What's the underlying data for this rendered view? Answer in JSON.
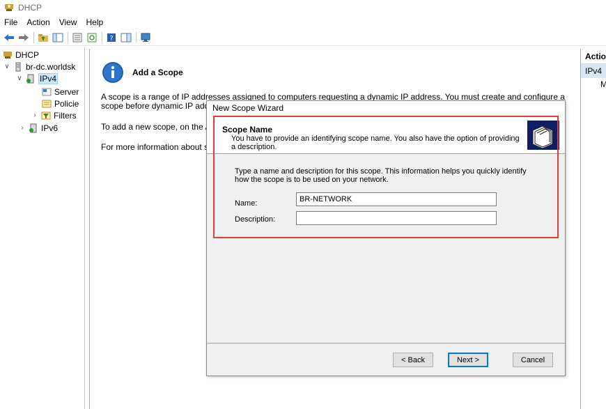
{
  "window": {
    "title": "DHCP"
  },
  "menu": [
    "File",
    "Action",
    "View",
    "Help"
  ],
  "toolbar": {
    "icons": [
      "back-arrow-icon",
      "forward-arrow-icon",
      "folder-up-icon",
      "show-hide-tree-icon",
      "properties-icon",
      "refresh-icon",
      "help-icon",
      "action-pane-icon",
      "monitor-icon"
    ]
  },
  "tree": {
    "root": "DHCP",
    "server": "br-dc.worldsk",
    "ipv4": "IPv4",
    "server_options": "Server",
    "policies": "Policie",
    "filters": "Filters",
    "ipv6": "IPv6"
  },
  "main": {
    "heading": "Add a Scope",
    "para1_line1": "A scope is a range of IP addresses assigned to computers requesting a dynamic IP address. You must create and configure a",
    "para1_line2": "scope before dynamic IP addr",
    "para2": "To add a new scope, on the A",
    "para3": "For more information about s"
  },
  "actions": {
    "header": "Actions",
    "selected": "IPv4",
    "item": "More Actions"
  },
  "wizard": {
    "title": "New Scope Wizard",
    "page_title": "Scope Name",
    "page_subtitle": "You have to provide an identifying scope name. You also have the option of providing a description.",
    "instructions": "Type a name and description for this scope. This information helps you quickly identify how the scope is to be used on your network.",
    "name_label": "Name:",
    "name_value": "BR-NETWORK",
    "description_label": "Description:",
    "description_value": "",
    "back_label": "< Back",
    "next_label": "Next >",
    "cancel_label": "Cancel"
  },
  "colors": {
    "highlight": "#e03c3c",
    "selection": "#cce8ff",
    "info_icon": "#1f5fae"
  }
}
